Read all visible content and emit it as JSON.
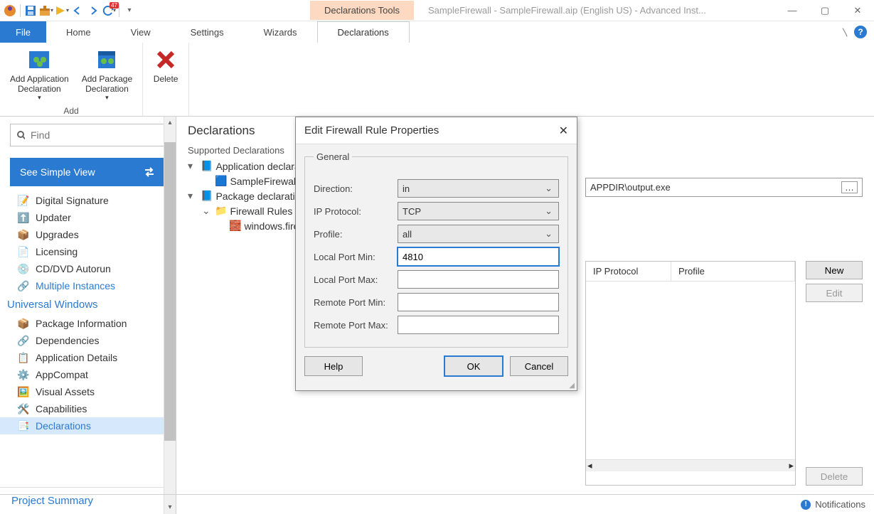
{
  "window": {
    "title": "SampleFirewall - SampleFirewall.aip (English US) - Advanced Inst...",
    "tools_tab": "Declarations Tools"
  },
  "qat_badge": "47",
  "tabs": {
    "file": "File",
    "home": "Home",
    "view": "View",
    "settings": "Settings",
    "wizards": "Wizards",
    "declarations": "Declarations"
  },
  "ribbon": {
    "add_app": "Add Application\nDeclaration",
    "add_pkg": "Add Package\nDeclaration",
    "delete": "Delete",
    "group_add": "Add"
  },
  "search_placeholder": "Find",
  "simple_view": "See Simple View",
  "nav": {
    "digital_signature": "Digital Signature",
    "updater": "Updater",
    "upgrades": "Upgrades",
    "licensing": "Licensing",
    "cddvd": "CD/DVD Autorun",
    "multiple": "Multiple Instances",
    "group_uw": "Universal Windows",
    "pkginfo": "Package Information",
    "deps": "Dependencies",
    "appdetails": "Application Details",
    "appcompat": "AppCompat",
    "visual": "Visual Assets",
    "caps": "Capabilities",
    "decls": "Declarations",
    "projsum": "Project Summary"
  },
  "decl": {
    "heading": "Declarations",
    "supported": "Supported Declarations",
    "appdecl": "Application declarat",
    "sample": "SampleFirewall",
    "pkgdecl": "Package declaration",
    "firewall_rules": "Firewall Rules",
    "rule": "windows.firev"
  },
  "right": {
    "path_value": "APPDIR\\output.exe",
    "th_ip": "IP Protocol",
    "th_profile": "Profile",
    "btn_new": "New",
    "btn_edit": "Edit",
    "btn_delete": "Delete"
  },
  "dialog": {
    "title": "Edit Firewall Rule Properties",
    "legend": "General",
    "lbl_direction": "Direction:",
    "val_direction": "in",
    "lbl_proto": "IP Protocol:",
    "val_proto": "TCP",
    "lbl_profile": "Profile:",
    "val_profile": "all",
    "lbl_lpmin": "Local Port Min:",
    "val_lpmin": "4810",
    "lbl_lpmax": "Local Port Max:",
    "val_lpmax": "",
    "lbl_rpmin": "Remote Port Min:",
    "val_rpmin": "",
    "lbl_rpmax": "Remote Port Max:",
    "val_rpmax": "",
    "help": "Help",
    "ok": "OK",
    "cancel": "Cancel"
  },
  "status": {
    "notifications": "Notifications"
  }
}
